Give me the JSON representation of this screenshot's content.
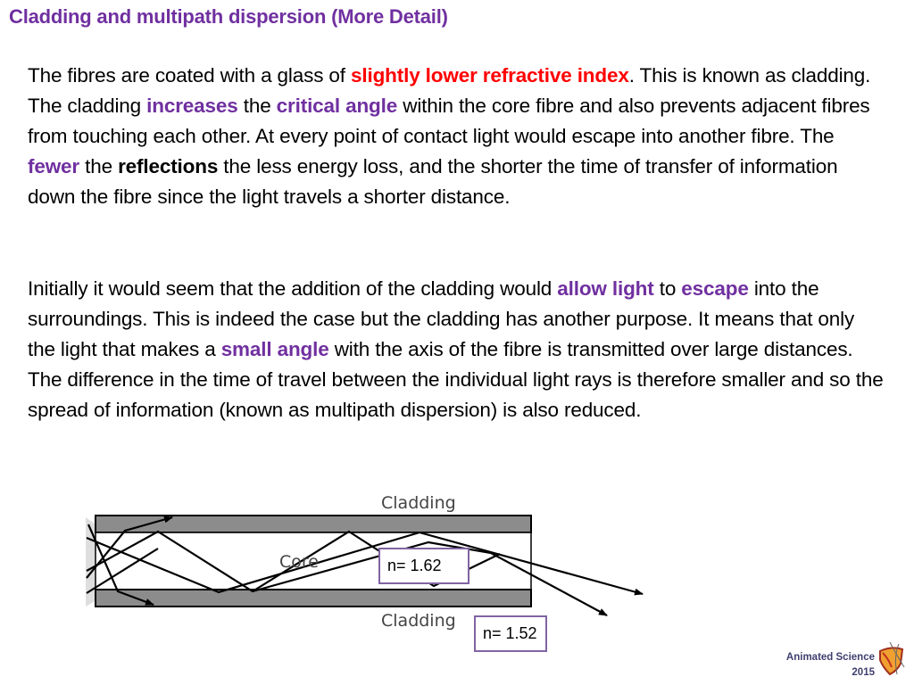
{
  "title": "Cladding and multipath dispersion (More Detail)",
  "paragraph1": {
    "s1": "The fibres are coated with a glass of ",
    "e1": "slightly lower refractive index",
    "s2": ". This is known as cladding. The cladding ",
    "e2": "increases",
    "s3": " the ",
    "e3": "critical angle",
    "s4": " within the core fibre and also prevents adjacent fibres from touching each other. At every point of contact light would escape into another fibre. The ",
    "e4": "fewer",
    "s5": " the ",
    "e5": "reflections",
    "s6": " the less energy loss, and the shorter the time of transfer of information down the fibre since the light travels a shorter distance."
  },
  "paragraph2": {
    "s1": "Initially it would seem that the addition of the cladding would ",
    "e1": "allow light",
    "s2": " to ",
    "e2": "escape",
    "s3": " into the surroundings. This is indeed the case but the cladding has another purpose. It means that only the light that makes a ",
    "e3": "small angle",
    "s4": " with the axis of the fibre is transmitted over large distances. The difference in the time of travel between the individual light rays is therefore smaller and so the spread of information (known as multipath dispersion) is also reduced."
  },
  "diagram": {
    "label_cladding_top": "Cladding",
    "label_core": "Core",
    "label_cladding_bottom": "Cladding",
    "core_index": "n= 1.62",
    "cladding_index": "n= 1.52"
  },
  "footer": {
    "brand": "Animated Science",
    "year": "2015",
    "logo_icon": "shield-logo-icon"
  },
  "colors": {
    "title": "#7030a0",
    "emphasis_red": "#ff0000",
    "emphasis_purple": "#7030a0",
    "cladding_fill": "#8c8c8c",
    "label_box_border": "#8064a2"
  }
}
